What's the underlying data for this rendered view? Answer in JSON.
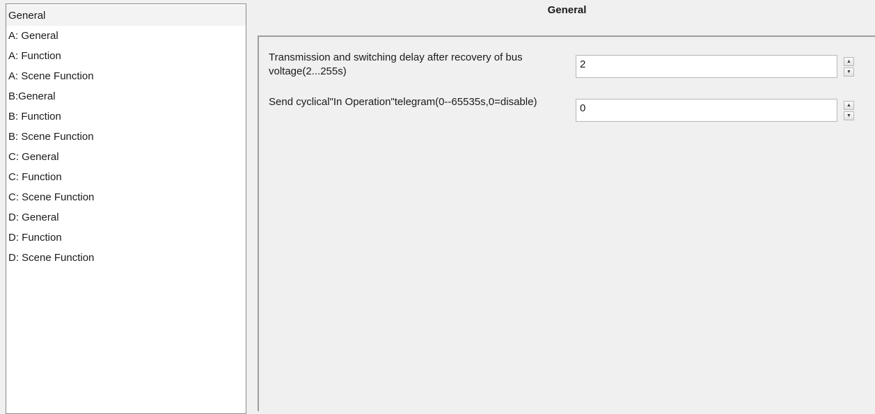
{
  "sidebar": {
    "items": [
      {
        "label": "General"
      },
      {
        "label": "A: General"
      },
      {
        "label": "A: Function"
      },
      {
        "label": "A: Scene Function"
      },
      {
        "label": "B:General"
      },
      {
        "label": "B: Function"
      },
      {
        "label": "B: Scene Function"
      },
      {
        "label": "C: General"
      },
      {
        "label": "C: Function"
      },
      {
        "label": "C: Scene Function"
      },
      {
        "label": "D: General"
      },
      {
        "label": "D: Function"
      },
      {
        "label": "D: Scene Function"
      }
    ]
  },
  "main": {
    "title": "General",
    "params": [
      {
        "label": "Transmission and switching delay after recovery of bus voltage(2...255s)",
        "value": "2"
      },
      {
        "label": "Send cyclical\"In Operation\"telegram(0--65535s,0=disable)",
        "value": "0"
      }
    ],
    "spin_up_icon": "▲",
    "spin_down_icon": "▼"
  }
}
